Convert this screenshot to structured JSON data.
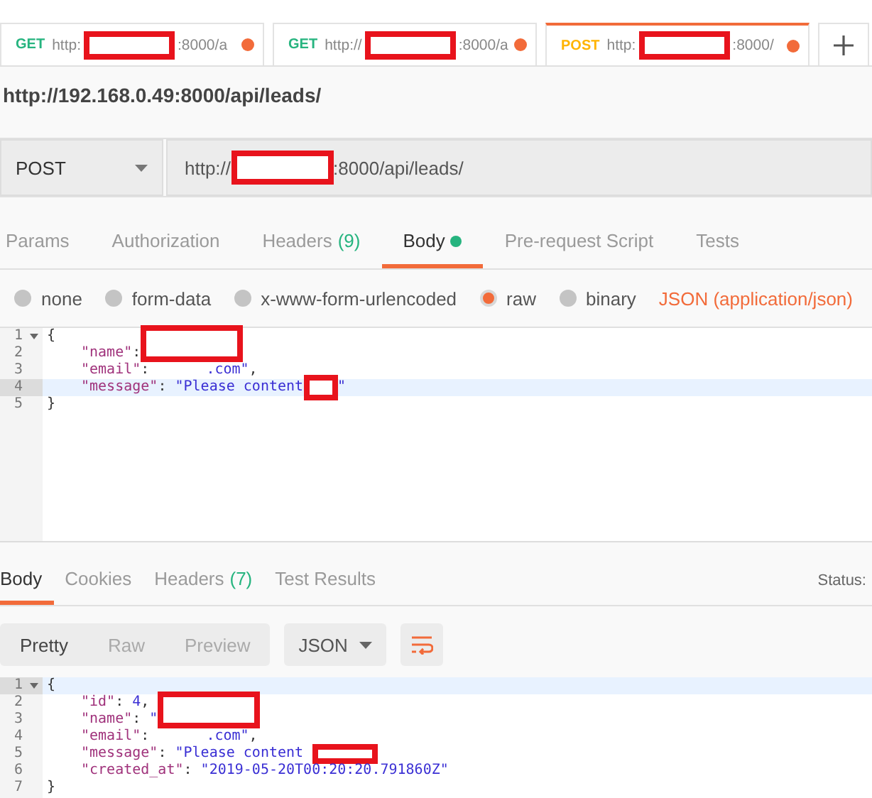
{
  "request_tabs": [
    {
      "method": "GET",
      "color": "#26b47f",
      "url_start": "http:",
      "url_end": ":8000/a",
      "unsaved": true,
      "selected": false
    },
    {
      "method": "GET",
      "color": "#26b47f",
      "url_start": "http://",
      "url_end": ":8000/a",
      "unsaved": true,
      "selected": false
    },
    {
      "method": "POST",
      "color": "#ffb400",
      "url_start": "http:",
      "url_end": ":8000/",
      "unsaved": true,
      "selected": true
    }
  ],
  "page_url": "http://192.168.0.49:8000/api/leads/",
  "request": {
    "method": "POST",
    "url_start": "http://",
    "url_end": ":8000/api/leads/"
  },
  "request_sections": [
    {
      "label": "Params",
      "selected": false,
      "dot": false
    },
    {
      "label": "Authorization",
      "selected": false,
      "dot": false
    },
    {
      "label": "Headers",
      "count": "(9)",
      "selected": false,
      "dot": false
    },
    {
      "label": "Body",
      "selected": true,
      "dot": true
    },
    {
      "label": "Pre-request Script",
      "selected": false,
      "dot": false
    },
    {
      "label": "Tests",
      "selected": false,
      "dot": false
    }
  ],
  "body_modes": [
    {
      "label": "none",
      "selected": false
    },
    {
      "label": "form-data",
      "selected": false
    },
    {
      "label": "x-www-form-urlencoded",
      "selected": false
    },
    {
      "label": "raw",
      "selected": true
    },
    {
      "label": "binary",
      "selected": false
    }
  ],
  "body_format": "JSON (application/json)",
  "request_body": {
    "lines": [
      {
        "number": "1",
        "foldable": true,
        "active": false,
        "tokens": [
          {
            "kind": "punct",
            "t": "{"
          }
        ]
      },
      {
        "number": "2",
        "foldable": false,
        "active": false,
        "tokens": [
          {
            "kind": "indent"
          },
          {
            "kind": "key",
            "t": "\"name\""
          },
          {
            "kind": "punct",
            "t": ":"
          },
          {
            "kind": "redaction-large"
          }
        ]
      },
      {
        "number": "3",
        "foldable": false,
        "active": false,
        "tokens": [
          {
            "kind": "indent"
          },
          {
            "kind": "key",
            "t": "\"email\""
          },
          {
            "kind": "punct",
            "t": ":"
          },
          {
            "kind": "redaction-gap"
          },
          {
            "kind": "string",
            "t": ".com\""
          },
          {
            "kind": "punct",
            "t": ","
          }
        ]
      },
      {
        "number": "4",
        "foldable": false,
        "active": true,
        "tokens": [
          {
            "kind": "indent"
          },
          {
            "kind": "key",
            "t": "\"message\""
          },
          {
            "kind": "punct",
            "t": ": "
          },
          {
            "kind": "string",
            "t": "\"Please content"
          },
          {
            "kind": "redaction-small"
          },
          {
            "kind": "string",
            "t": "\""
          }
        ]
      },
      {
        "number": "5",
        "foldable": false,
        "active": false,
        "tokens": [
          {
            "kind": "punct",
            "t": "}"
          }
        ]
      }
    ]
  },
  "response_sections": [
    {
      "label": "Body",
      "selected": true
    },
    {
      "label": "Cookies",
      "selected": false
    },
    {
      "label": "Headers",
      "count": "(7)",
      "selected": false
    },
    {
      "label": "Test Results",
      "selected": false
    }
  ],
  "status_label": "Status:",
  "view_modes": [
    {
      "label": "Pretty",
      "selected": true
    },
    {
      "label": "Raw",
      "selected": false
    },
    {
      "label": "Preview",
      "selected": false
    }
  ],
  "format_select": "JSON",
  "response_body": {
    "lines": [
      {
        "number": "1",
        "foldable": true,
        "active": true,
        "tokens": [
          {
            "kind": "punct",
            "t": "{"
          }
        ]
      },
      {
        "number": "2",
        "foldable": false,
        "active": false,
        "tokens": [
          {
            "kind": "indent"
          },
          {
            "kind": "key",
            "t": "\"id\""
          },
          {
            "kind": "punct",
            "t": ": "
          },
          {
            "kind": "number",
            "t": "4"
          },
          {
            "kind": "punct",
            "t": ","
          }
        ]
      },
      {
        "number": "3",
        "foldable": false,
        "active": false,
        "tokens": [
          {
            "kind": "indent"
          },
          {
            "kind": "key",
            "t": "\"name\""
          },
          {
            "kind": "punct",
            "t": ": "
          },
          {
            "kind": "string",
            "t": "\""
          },
          {
            "kind": "redaction-large"
          }
        ]
      },
      {
        "number": "4",
        "foldable": false,
        "active": false,
        "tokens": [
          {
            "kind": "indent"
          },
          {
            "kind": "key",
            "t": "\"email\""
          },
          {
            "kind": "punct",
            "t": ":"
          },
          {
            "kind": "redaction-gap"
          },
          {
            "kind": "string",
            "t": ".com\""
          },
          {
            "kind": "punct",
            "t": ","
          }
        ]
      },
      {
        "number": "5",
        "foldable": false,
        "active": false,
        "tokens": [
          {
            "kind": "indent"
          },
          {
            "kind": "key",
            "t": "\"message\""
          },
          {
            "kind": "punct",
            "t": ": "
          },
          {
            "kind": "string",
            "t": "\"Please content "
          },
          {
            "kind": "redaction-medium"
          }
        ]
      },
      {
        "number": "6",
        "foldable": false,
        "active": false,
        "tokens": [
          {
            "kind": "indent"
          },
          {
            "kind": "key",
            "t": "\"created_at\""
          },
          {
            "kind": "punct",
            "t": ": "
          },
          {
            "kind": "string",
            "t": "\"2019-05-20T00:20:20.791860Z\""
          }
        ]
      },
      {
        "number": "7",
        "foldable": false,
        "active": false,
        "tokens": [
          {
            "kind": "punct",
            "t": "}"
          }
        ]
      }
    ]
  }
}
